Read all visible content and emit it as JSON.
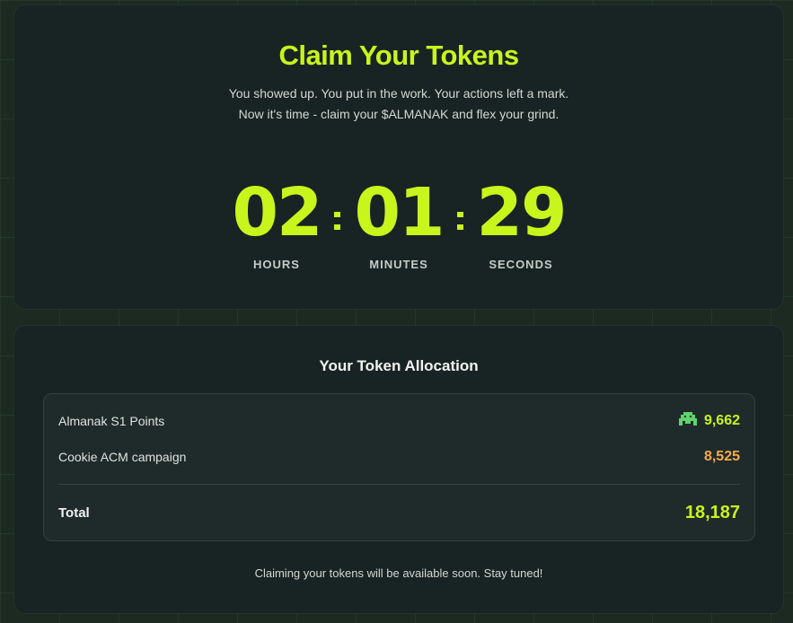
{
  "claim": {
    "title": "Claim Your Tokens",
    "description_line1": "You showed up. You put in the work. Your actions left a mark.",
    "description_line2": "Now it's time - claim your $ALMANAK and flex your grind.",
    "countdown": {
      "hours": "02",
      "minutes": "01",
      "seconds": "29",
      "hours_label": "HOURS",
      "minutes_label": "MINUTES",
      "seconds_label": "SECONDS",
      "separator": ":"
    }
  },
  "allocation": {
    "title": "Your Token Allocation",
    "rows": [
      {
        "label": "Almanak S1 Points",
        "value": "9,662",
        "color": "#c8f51c",
        "icon": "space-invader-icon",
        "icon_color": "#5fd36c"
      },
      {
        "label": "Cookie ACM campaign",
        "value": "8,525",
        "color": "#f7a94a"
      }
    ],
    "total": {
      "label": "Total",
      "value": "18,187",
      "color": "#c8f51c"
    },
    "footer": "Claiming your tokens will be available soon. Stay tuned!"
  },
  "colors": {
    "accent": "#c8f51c",
    "background": "#1c2a22",
    "card": "#182423"
  }
}
